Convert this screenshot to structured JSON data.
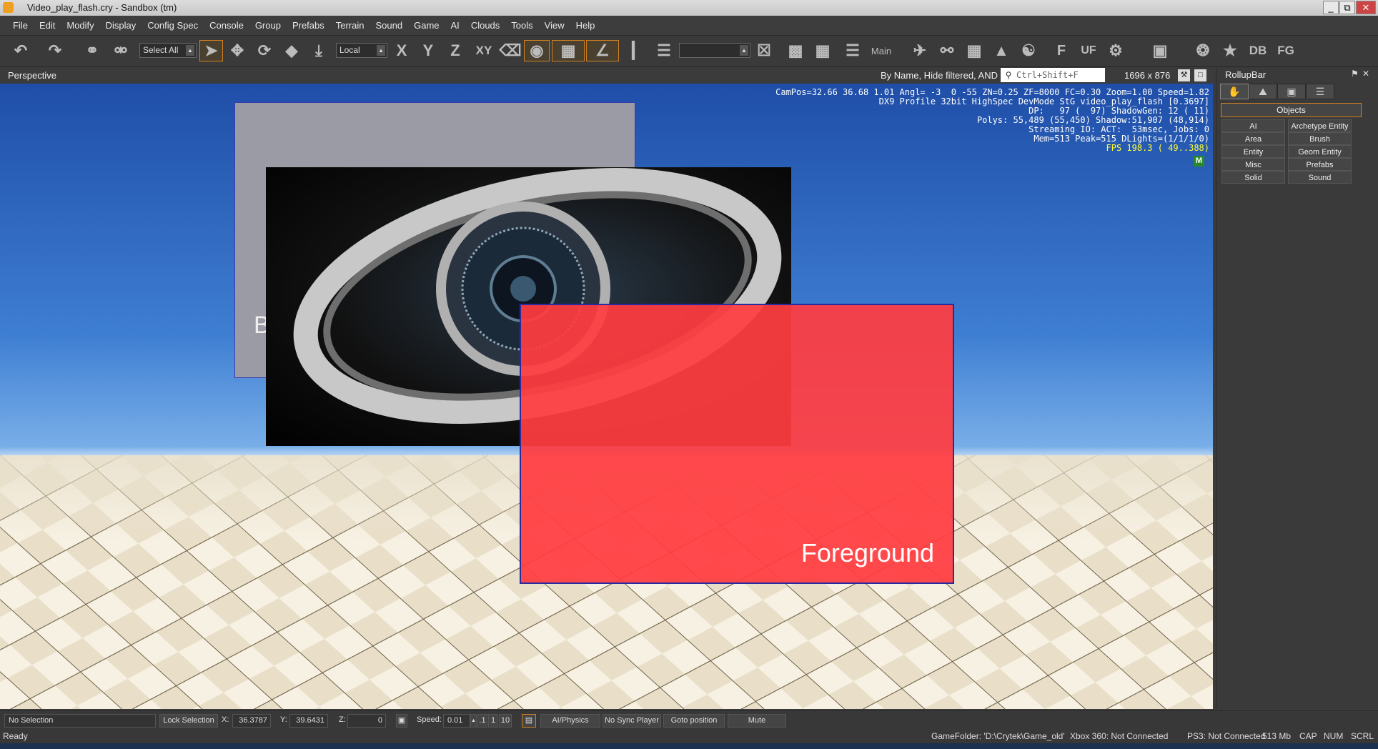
{
  "window": {
    "title": "Video_play_flash.cry - Sandbox (tm)",
    "controls": [
      "_",
      "⧉",
      "✕"
    ]
  },
  "menu": [
    "File",
    "Edit",
    "Modify",
    "Display",
    "Config Spec",
    "Console",
    "Group",
    "Prefabs",
    "Terrain",
    "Sound",
    "Game",
    "AI",
    "Clouds",
    "Tools",
    "View",
    "Help"
  ],
  "toolbar": {
    "select_mode": "Select All",
    "coord_system": "Local",
    "axes": [
      "X",
      "Y",
      "Z",
      "XY"
    ],
    "layer_label": "Main",
    "tools_text": [
      "F",
      "UF",
      "DB",
      "FG"
    ]
  },
  "viewport": {
    "name": "Perspective",
    "filter_text": "By Name, Hide filtered, AND",
    "search_placeholder": "Ctrl+Shift+F",
    "resolution": "1696 x 876",
    "stats": [
      "CamPos=32.66 36.68 1.01 Angl= -3  0 -55 ZN=0.25 ZF=8000 FC=0.30 Zoom=1.00 Speed=1.82",
      "DX9 Profile 32bit HighSpec DevMode StG video_play_flash [0.3697]",
      "DP:   97 (  97) ShadowGen: 12 ( 11)",
      "Polys: 55,489 (55,450) Shadow:51,907 (48,914)",
      "Streaming IO: ACT:  53msec, Jobs: 0",
      "Mem=513 Peak=515 DLights=(1/1/1/0)"
    ],
    "fps": "FPS 198.3 ( 49..388)",
    "badge": "M",
    "background_label": "B",
    "foreground_label": "Foreground"
  },
  "rollup": {
    "title": "RollupBar",
    "section": "Objects",
    "buttons": [
      "AI",
      "Archetype Entity",
      "Area",
      "Brush",
      "Entity",
      "Geom Entity",
      "Misc",
      "Prefabs",
      "Solid",
      "Sound"
    ]
  },
  "status": {
    "selection": "No Selection",
    "lock_selection": "Lock Selection",
    "x_label": "X:",
    "x_value": "36.3787",
    "y_label": "Y:",
    "y_value": "39.6431",
    "z_label": "Z:",
    "z_value": "0",
    "speed_label": "Speed:",
    "speed_value": "0.01",
    "speed_presets": [
      ".1",
      "1",
      "10"
    ],
    "ai_physics": "AI/Physics",
    "sync_player": "No Sync Player",
    "goto_position": "Goto position",
    "mute": "Mute"
  },
  "readybar": {
    "state": "Ready",
    "gamefolder": "GameFolder: 'D:\\Crytek\\Game_old'",
    "xbox": "Xbox 360: Not Connected",
    "ps3": "PS3: Not Connected",
    "memory": "513 Mb",
    "cap": "CAP",
    "num": "NUM",
    "scrl": "SCRL"
  }
}
